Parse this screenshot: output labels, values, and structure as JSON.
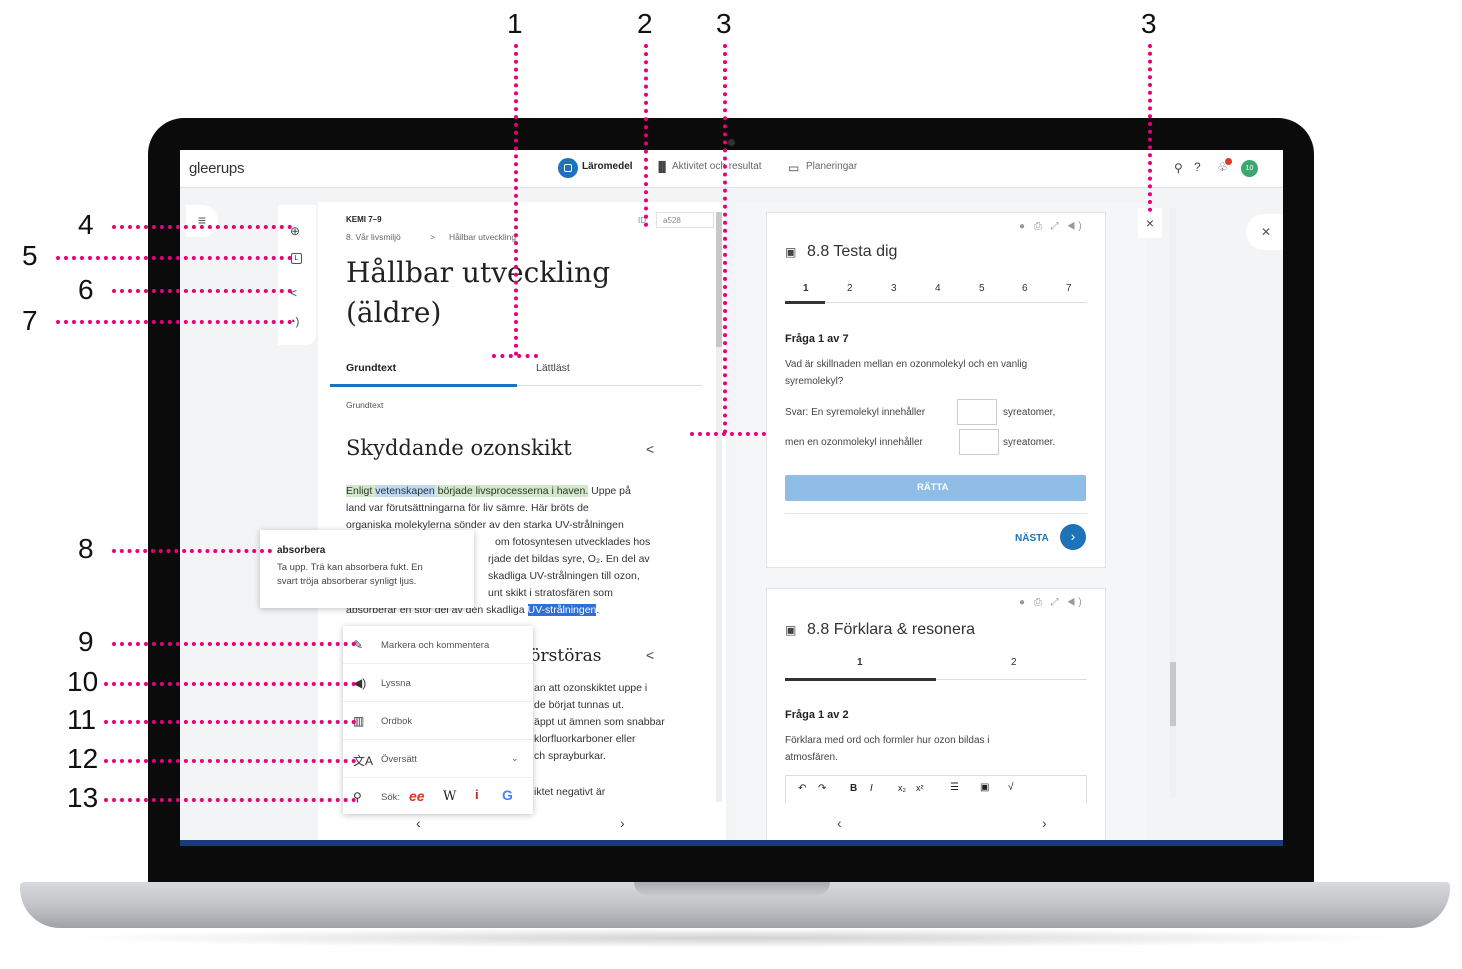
{
  "callouts": [
    "1",
    "2",
    "3",
    "3",
    "4",
    "5",
    "6",
    "7",
    "8",
    "9",
    "10",
    "11",
    "12",
    "13"
  ],
  "brand": {
    "logo": "gleerups",
    "accent": "#1d72b8",
    "avatar": "10"
  },
  "topnav": {
    "laromedel": "Läromedel",
    "aktivitet": "Aktivitet och resultat",
    "planeringar": "Planeringar"
  },
  "left": {
    "course": "KEMI 7–9",
    "id_label": "ID:",
    "id_value": "a528",
    "crumb1": "8. Vår livsmiljö",
    "crumb_sep": ">",
    "crumb2": "Hållbar utveckling",
    "title_line1": "Hållbar utveckling",
    "title_line2": "(äldre)",
    "tab1": "Grundtext",
    "tab2": "Lättläst",
    "section_label": "Grundtext",
    "heading1": "Skyddande ozonskikt",
    "p1": {
      "a": "Enligt ",
      "b": "vetenskapen",
      "c": " började livsprocesserna i haven.",
      "d": " Uppe på"
    },
    "p_lines": [
      "land var förutsättningarna för liv sämre. Här bröts de",
      "organiska molekylerna sönder av den starka UV-strålningen"
    ],
    "p_right_lines": [
      "om fotosyntesen utvecklades hos",
      "rjade det bildas syre, O₂. En del av",
      "skadliga UV-strålningen till ozon,",
      "unt skikt i stratosfären som"
    ],
    "p_last": {
      "a": "absorberar en stor del av den skadliga ",
      "b": "UV-strålningen",
      "c": "."
    },
    "heading2_partial": "förstöras",
    "p2_lines": [
      "an att ozonskiktet uppe i",
      "de börjat tunnas ut.",
      "äppt ut ämnen som snabbar",
      "klorfluorkarboner eller",
      "ch sprayburkar."
    ],
    "p3_partial": "iktet negativt är"
  },
  "tooltip": {
    "word": "absorbera",
    "line1": "Ta upp. Trä kan absorbera fukt. En",
    "line2": "svart tröja absorberar synligt ljus."
  },
  "context_menu": {
    "mark": "Markera och kommentera",
    "listen": "Lyssna",
    "dictionary": "Ordbok",
    "translate": "Översätt",
    "search_label": "Sök:"
  },
  "quiz1": {
    "title": "8.8 Testa dig",
    "tabs": [
      "1",
      "2",
      "3",
      "4",
      "5",
      "6",
      "7"
    ],
    "question_label": "Fråga 1 av 7",
    "q_line1": "Vad är skillnaden mellan en ozonmolekyl och en vanlig",
    "q_line2": "syremolekyl?",
    "a_line1_pre": "Svar: En syremolekyl innehåller",
    "a_line1_post": "syreatomer,",
    "a_line2_pre": "men en ozonmolekyl innehåller",
    "a_line2_post": "syreatomer.",
    "check": "RÄTTA",
    "next": "NÄSTA"
  },
  "quiz2": {
    "title": "8.8 Förklara & resonera",
    "tabs": [
      "1",
      "2"
    ],
    "question_label": "Fråga 1 av 2",
    "q_line1": "Förklara med ord och formler hur ozon bildas i",
    "q_line2": "atmosfären."
  }
}
